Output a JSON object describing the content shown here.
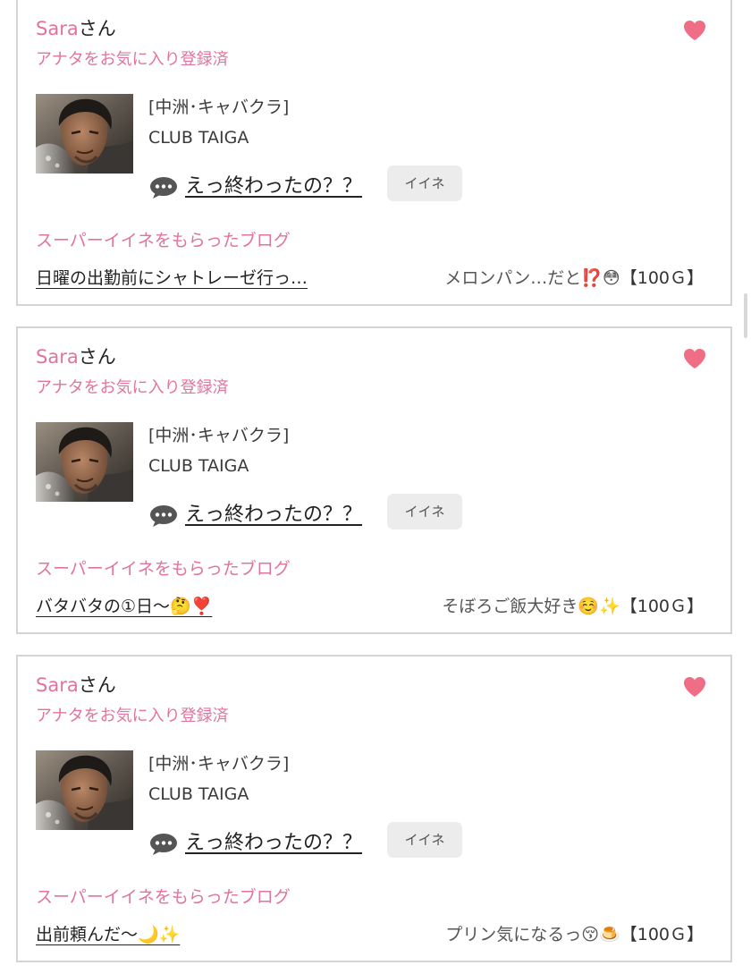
{
  "colors": {
    "accent_pink": "#e2739e",
    "heart": "#f06d86",
    "border": "#d4d4d4",
    "like_button_bg": "#ececec"
  },
  "icons": {
    "favorite": "heart-icon",
    "message": "speech-bubble-icon"
  },
  "cards": [
    {
      "user_name": "Sara",
      "honorific": "さん",
      "favorite_status": "アナタをお気に入り登録済",
      "area": "[中洲･キャバクラ]",
      "shop": "CLUB TAIGA",
      "message": "えっ終わったの？？",
      "like_label": "イイネ",
      "section_title": "スーパーイイネをもらったブログ",
      "blog_title": "日曜の出勤前にシャトレーゼ行っ…",
      "gift_name": "メロンパン…だと⁉️😳",
      "gift_price": "【100Ｇ】"
    },
    {
      "user_name": "Sara",
      "honorific": "さん",
      "favorite_status": "アナタをお気に入り登録済",
      "area": "[中洲･キャバクラ]",
      "shop": "CLUB TAIGA",
      "message": "えっ終わったの？？",
      "like_label": "イイネ",
      "section_title": "スーパーイイネをもらったブログ",
      "blog_title": "バタバタの①日〜🤔❣️",
      "gift_name": "そぼろご飯大好き☺️✨",
      "gift_price": "【100Ｇ】"
    },
    {
      "user_name": "Sara",
      "honorific": "さん",
      "favorite_status": "アナタをお気に入り登録済",
      "area": "[中洲･キャバクラ]",
      "shop": "CLUB TAIGA",
      "message": "えっ終わったの？？",
      "like_label": "イイネ",
      "section_title": "スーパーイイネをもらったブログ",
      "blog_title": "出前頼んだ〜🌙✨",
      "gift_name": "プリン気になるっ😚🍮",
      "gift_price": "【100Ｇ】"
    }
  ]
}
